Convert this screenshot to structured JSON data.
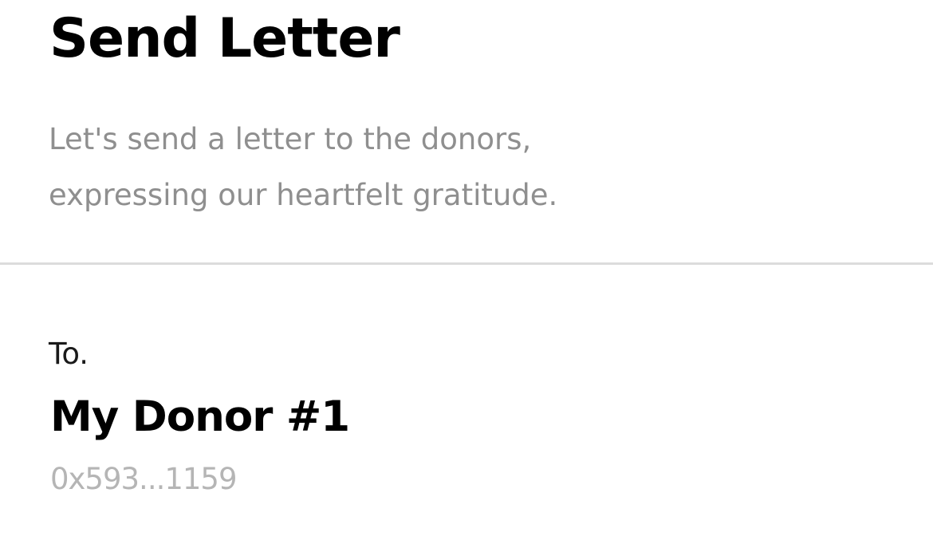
{
  "header": {
    "title": "Send Letter",
    "subtitle_lines": [
      "Let's send a letter to the donors,",
      "expressing our heartfelt gratitude."
    ]
  },
  "recipient": {
    "label": "To.",
    "name": "My Donor #1",
    "address": "0x593...1159"
  },
  "colors": {
    "title": "#000000",
    "subtitle": "#8f8f8f",
    "divider": "#dcdcdc",
    "address": "#b5b5b5"
  }
}
